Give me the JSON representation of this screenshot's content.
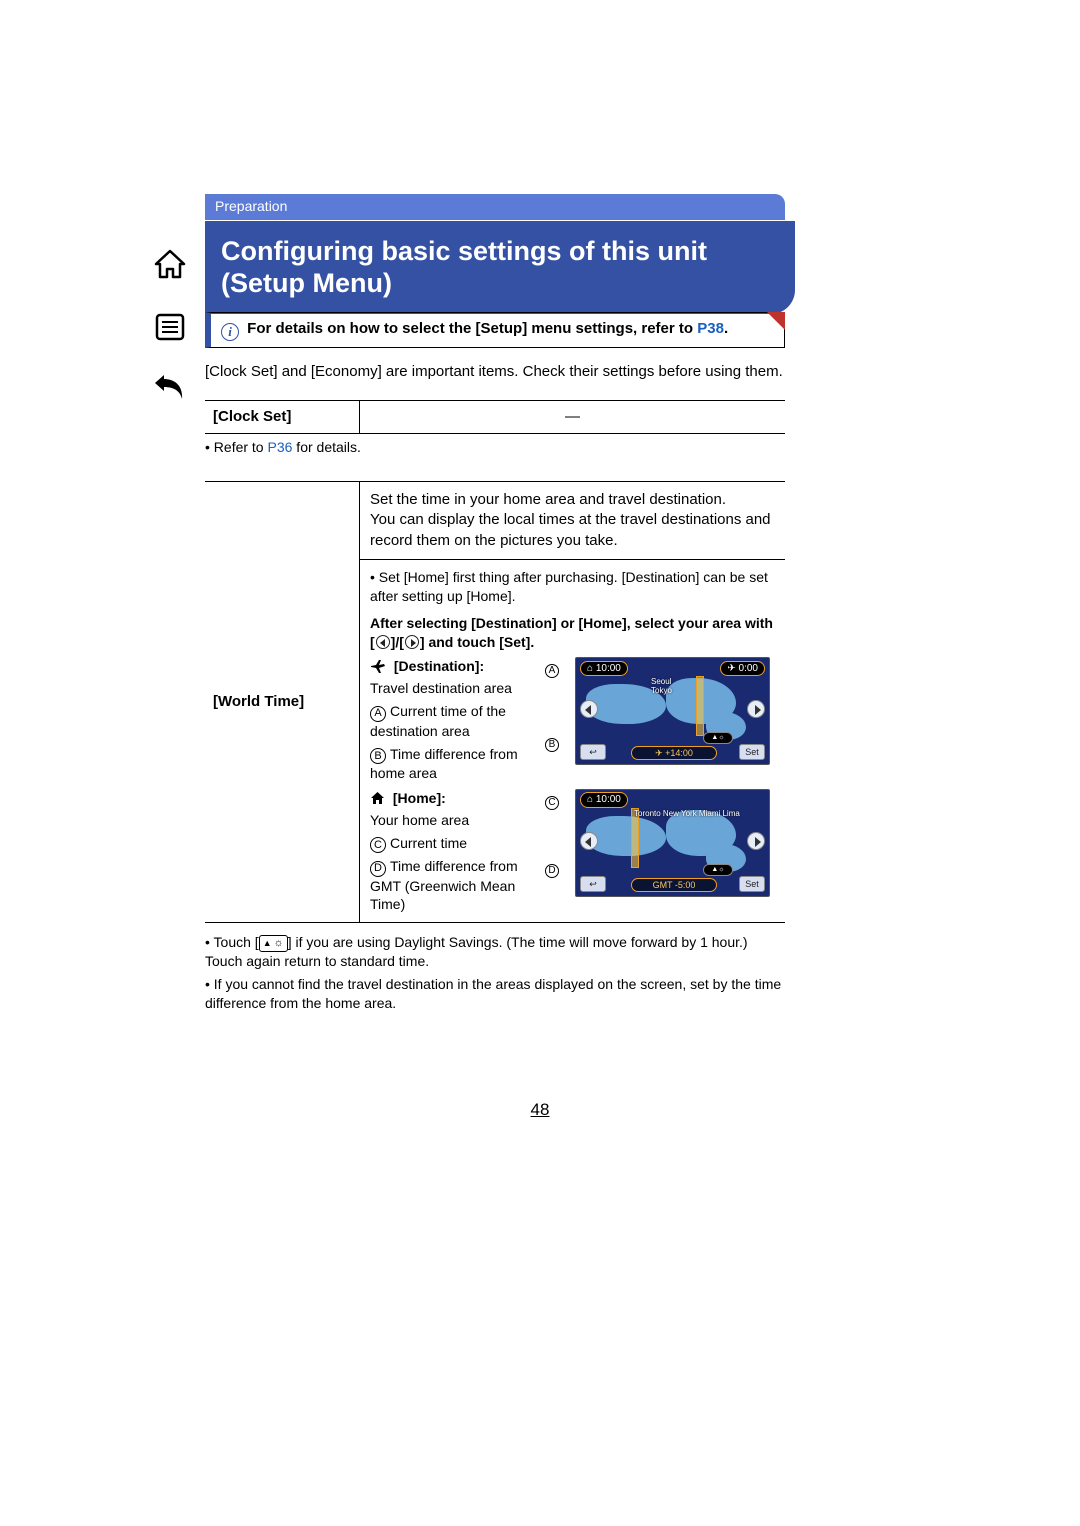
{
  "section": "Preparation",
  "title_line1": "Configuring basic settings of this unit",
  "title_line2": "(Setup Menu)",
  "note": {
    "prefix": "For details on how to select the [Setup] menu settings, refer to ",
    "ref": "P38",
    "suffix": "."
  },
  "intro": "[Clock Set] and [Economy] are important items. Check their settings before using them.",
  "clock_set": {
    "label": "[Clock Set]",
    "value": "—",
    "refer_prefix": "Refer to ",
    "refer_link": "P36",
    "refer_suffix": " for details."
  },
  "world_time": {
    "label": "[World Time]",
    "intro1": "Set the time in your home area and travel destination.",
    "intro2": "You can display the local times at the travel destinations and record them on the pictures you take.",
    "tip": "Set [Home] first thing after purchasing. [Destination] can be set after setting up [Home].",
    "instruction_prefix": "After selecting [Destination] or [Home], select your area with [",
    "instruction_mid": "]/[",
    "instruction_suffix": "] and touch [Set].",
    "destination": {
      "heading": "[Destination]:",
      "sub": "Travel destination area",
      "items": {
        "A": "Current time of the destination area",
        "B": "Time difference from home area"
      }
    },
    "home": {
      "heading": "[Home]:",
      "sub": "Your home area",
      "items": {
        "C": "Current time",
        "D": "Time difference from GMT (Greenwich Mean Time)"
      }
    },
    "shot_dest": {
      "top_left": "10:00",
      "top_right": "0:00",
      "cities": "Seoul\nTokyo",
      "diff": "+14:00",
      "set": "Set",
      "back": "↩"
    },
    "shot_home": {
      "top_left": "10:00",
      "cities": "Toronto\nNew York\nMiami\nLima",
      "diff": "GMT -5:00",
      "set": "Set",
      "back": "↩"
    }
  },
  "footnotes": {
    "f1_prefix": "Touch [",
    "f1_chip": "☼",
    "f1_suffix": "] if you are using Daylight Savings. (The time will move forward by 1 hour.) Touch again return to standard time.",
    "f2": "If you cannot find the travel destination in the areas displayed on the screen, set by the time difference from the home area."
  },
  "page": "48",
  "labels": {
    "A": "A",
    "B": "B",
    "C": "C",
    "D": "D"
  }
}
